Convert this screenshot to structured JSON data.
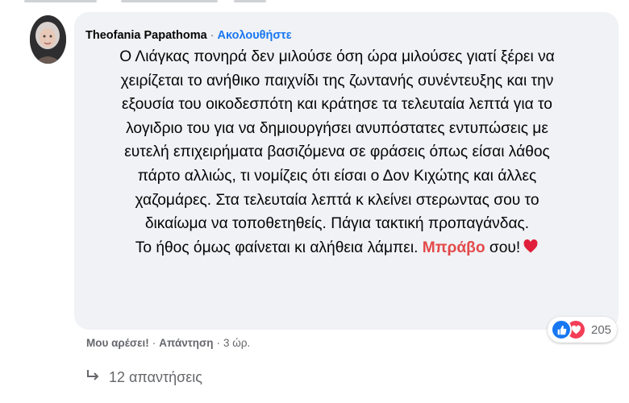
{
  "comment": {
    "author": "Theofania Papathoma",
    "separator": "·",
    "follow_label": "Ακολουθήστε",
    "lines": [
      "Ο Λιάγκας πονηρά δεν μιλούσε όση ώρα μιλούσες γιατί ξέρει να",
      "χειρίζεται το ανήθικο παιχνίδι της ζωντανής συνέντευξης και την",
      "εξουσία του οικοδεσπότη και κράτησε τα τελευταία λεπτά για το",
      "λογιδριο του για να δημιουργήσει ανυπόστατες εντυπώσεις με",
      "ευτελή επιχειρήματα βασιζόμενα σε φράσεις όπως είσαι λάθος",
      "πάρτο αλλιώς, τι νομίζεις ότι είσαι ο Δον Κιχώτης και άλλες",
      "χαζομάρες. Στα τελευταία λεπτά κ κλείνει στερωντας σου το",
      "δικαίωμα να τοποθετηθείς. Πάγια τακτική προπαγάνδας."
    ],
    "last_line_before": "Το ήθος όμως φαίνεται κι αλήθεια λάμπει.",
    "last_line_bold": "Μπράβο",
    "last_line_after": "σου!",
    "heart_icon": "red-heart-emoji"
  },
  "reactions": {
    "icons": [
      "like-icon",
      "love-icon"
    ],
    "count": "205",
    "like_color": "#1877f2",
    "love_color": "#f33e58"
  },
  "actions": {
    "like_label": "Μου αρέσει!",
    "reply_label": "Απάντηση",
    "dot": "·",
    "time": "3 ώρ."
  },
  "replies": {
    "label": "12 απαντήσεις"
  },
  "colors": {
    "bubble_bg": "#f0f2f5",
    "link_blue": "#1877f2",
    "muted": "#65676b",
    "bravo_red": "#e4494a"
  }
}
